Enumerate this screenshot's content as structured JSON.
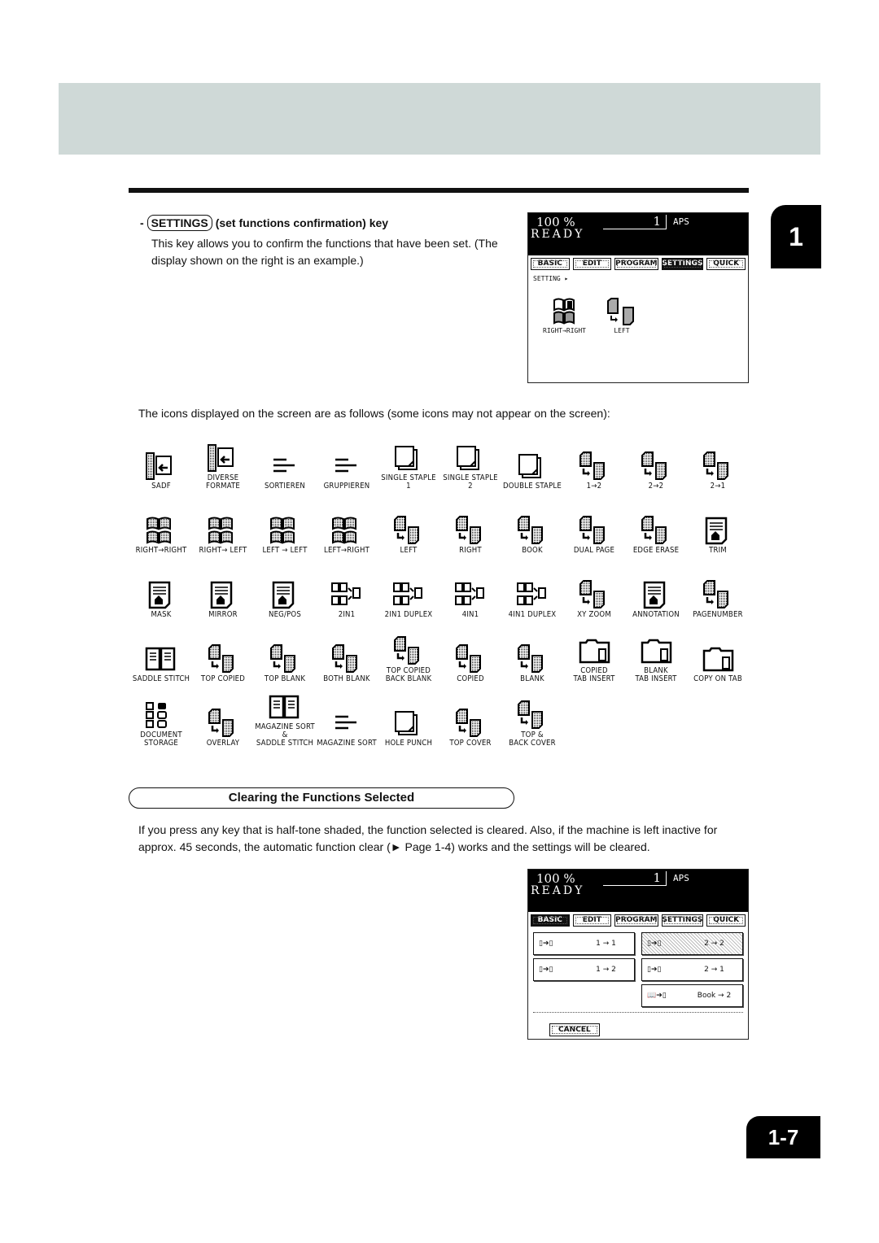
{
  "page": {
    "chapter_number": "1",
    "page_number": "1-7"
  },
  "settings_section": {
    "key_label": "SETTINGS",
    "dash": "-",
    "title_rest": "(set functions confirmation) key",
    "description": "This key allows you to confirm the functions that have been set. (The display shown on the right is an example.)"
  },
  "lcd_settings": {
    "zoom": "100 %",
    "count": "1",
    "paper": "APS",
    "status": "READY",
    "tabs": [
      {
        "label": "BASIC",
        "active": false
      },
      {
        "label": "EDIT",
        "active": false
      },
      {
        "label": "PROGRAM",
        "active": false
      },
      {
        "label": "SETTINGS",
        "active": true
      },
      {
        "label": "QUICK",
        "active": false
      }
    ],
    "setting_label": "SETTING ▸",
    "icons": [
      {
        "icon": "book-right-right-icon",
        "label": "RIGHT→RIGHT"
      },
      {
        "icon": "duplex-left-icon",
        "label": "LEFT"
      }
    ]
  },
  "icons_intro": "The icons displayed on the screen are as follows (some icons may not appear on the screen):",
  "icon_rows": [
    [
      {
        "icon": "sadf-icon",
        "label": "SADF"
      },
      {
        "icon": "diverse-formate-icon",
        "label": "DIVERSE\nFORMATE"
      },
      {
        "icon": "sort-icon",
        "label": "SORTIEREN"
      },
      {
        "icon": "group-icon",
        "label": "GRUPPIEREN"
      },
      {
        "icon": "single-staple-1-icon",
        "label": "SINGLE STAPLE\n1"
      },
      {
        "icon": "single-staple-2-icon",
        "label": "SINGLE STAPLE\n2"
      },
      {
        "icon": "double-staple-icon",
        "label": "DOUBLE STAPLE"
      },
      {
        "icon": "duplex-1-2-icon",
        "label": "1→2"
      },
      {
        "icon": "duplex-2-2-icon",
        "label": "2→2"
      },
      {
        "icon": "duplex-2-1-icon",
        "label": "2→1"
      }
    ],
    [
      {
        "icon": "book-right-right-icon",
        "label": "RIGHT→RIGHT"
      },
      {
        "icon": "book-right-left-icon",
        "label": "RIGHT→ LEFT"
      },
      {
        "icon": "book-left-left-icon",
        "label": "LEFT → LEFT"
      },
      {
        "icon": "book-left-right-icon",
        "label": "LEFT→RIGHT"
      },
      {
        "icon": "duplex-left-icon",
        "label": "LEFT"
      },
      {
        "icon": "duplex-right-icon",
        "label": "RIGHT"
      },
      {
        "icon": "book-icon",
        "label": "BOOK"
      },
      {
        "icon": "dual-page-icon",
        "label": "DUAL PAGE"
      },
      {
        "icon": "edge-erase-icon",
        "label": "EDGE ERASE"
      },
      {
        "icon": "trim-icon",
        "label": "TRIM"
      }
    ],
    [
      {
        "icon": "mask-icon",
        "label": "MASK"
      },
      {
        "icon": "mirror-icon",
        "label": "MIRROR"
      },
      {
        "icon": "neg-pos-icon",
        "label": "NEG/POS"
      },
      {
        "icon": "2in1-icon",
        "label": "2IN1"
      },
      {
        "icon": "2in1-duplex-icon",
        "label": "2IN1 DUPLEX"
      },
      {
        "icon": "4in1-icon",
        "label": "4IN1"
      },
      {
        "icon": "4in1-duplex-icon",
        "label": "4IN1 DUPLEX"
      },
      {
        "icon": "xy-zoom-icon",
        "label": "XY ZOOM"
      },
      {
        "icon": "annotation-icon",
        "label": "ANNOTATION"
      },
      {
        "icon": "page-number-icon",
        "label": "PAGENUMBER"
      }
    ],
    [
      {
        "icon": "saddle-stitch-icon",
        "label": "SADDLE STITCH"
      },
      {
        "icon": "top-copied-icon",
        "label": "TOP COPIED"
      },
      {
        "icon": "top-blank-icon",
        "label": "TOP BLANK"
      },
      {
        "icon": "both-blank-icon",
        "label": "BOTH BLANK"
      },
      {
        "icon": "top-copied-back-blank-icon",
        "label": "TOP COPIED\nBACK BLANK"
      },
      {
        "icon": "copied-icon",
        "label": "COPIED"
      },
      {
        "icon": "blank-icon",
        "label": "BLANK"
      },
      {
        "icon": "copied-tab-insert-icon",
        "label": "COPIED\nTAB INSERT"
      },
      {
        "icon": "blank-tab-insert-icon",
        "label": "BLANK\nTAB INSERT"
      },
      {
        "icon": "copy-on-tab-icon",
        "label": "COPY ON TAB"
      }
    ],
    [
      {
        "icon": "document-storage-icon",
        "label": "DOCUMENT\nSTORAGE"
      },
      {
        "icon": "overlay-icon",
        "label": "OVERLAY"
      },
      {
        "icon": "magazine-sort-saddle-stitch-icon",
        "label": "MAGAZINE SORT\n&\nSADDLE STITCH"
      },
      {
        "icon": "magazine-sort-icon",
        "label": "MAGAZINE SORT"
      },
      {
        "icon": "hole-punch-icon",
        "label": "HOLE PUNCH"
      },
      {
        "icon": "top-cover-icon",
        "label": "TOP COVER"
      },
      {
        "icon": "top-back-cover-icon",
        "label": "TOP &\nBACK COVER"
      }
    ]
  ],
  "clearing_section": {
    "title": "Clearing the Functions Selected",
    "description": "If you press any key that is half-tone shaded, the function selected is cleared. Also, if the machine is left inactive for approx. 45 seconds, the automatic function clear (► Page 1-4) works and the settings will be cleared."
  },
  "lcd_basic": {
    "zoom": "100 %",
    "count": "1",
    "paper": "APS",
    "status": "READY",
    "tabs": [
      {
        "label": "BASIC",
        "active": true
      },
      {
        "label": "EDIT",
        "active": false
      },
      {
        "label": "PROGRAM",
        "active": false
      },
      {
        "label": "SETTINGS",
        "active": false
      },
      {
        "label": "QUICK",
        "active": false
      }
    ],
    "buttons": [
      {
        "label": "1 → 1",
        "from": "1",
        "to": "1",
        "shaded": false
      },
      {
        "label": "2 → 2",
        "from": "2",
        "to": "2",
        "shaded": true
      },
      {
        "label": "1 → 2",
        "from": "1",
        "to": "2",
        "shaded": false
      },
      {
        "label": "2 → 1",
        "from": "2",
        "to": "1",
        "shaded": false
      },
      {
        "label": "Book → 2",
        "from": "book",
        "to": "2",
        "shaded": false
      }
    ],
    "cancel_label": "CANCEL"
  }
}
